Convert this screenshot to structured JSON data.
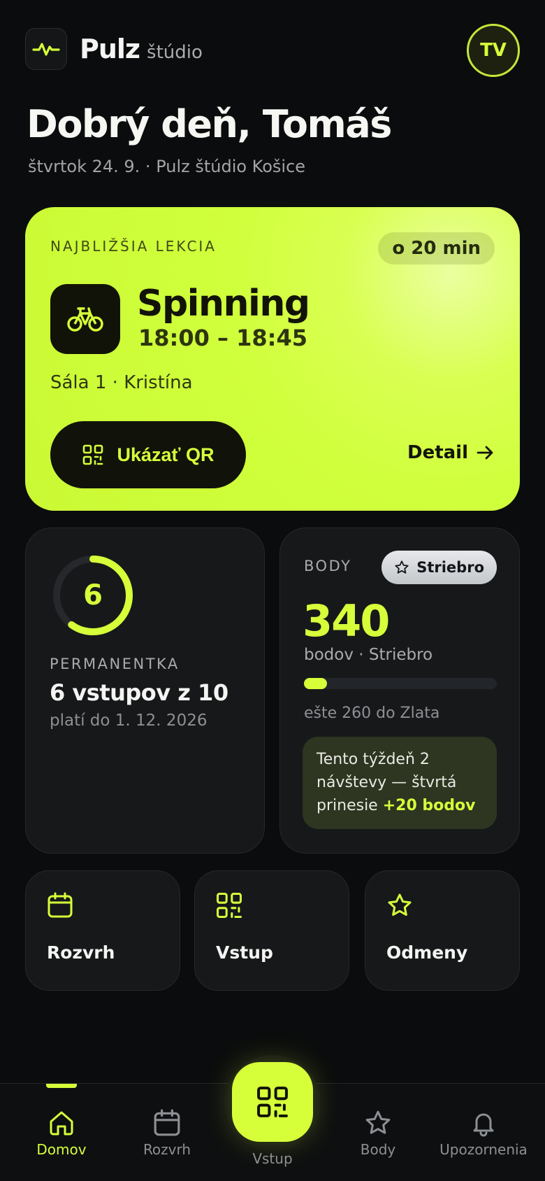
{
  "header": {
    "brand": "Pulz",
    "brand_suffix": "štúdio",
    "avatar_initials": "TV"
  },
  "greeting": {
    "title": "Dobrý deň, Tomáš",
    "subtitle": "štvrtok 24. 9. · Pulz štúdio Košice"
  },
  "next_class": {
    "label": "NAJBLIŽŠIA LEKCIA",
    "badge": "o 20 min",
    "name": "Spinning",
    "time": "18:00 – 18:45",
    "place": "Sála 1 · Kristína",
    "qr_button": "Ukázať QR",
    "detail_link": "Detail"
  },
  "pass": {
    "count": "6",
    "used": 6,
    "total": 10,
    "label": "PERMANENTKA",
    "value": "6 vstupov z 10",
    "valid": "platí do 1. 12. 2026"
  },
  "points": {
    "label": "BODY",
    "tier": "Striebro",
    "value": "340",
    "sub": "bodov · Striebro",
    "progress": 0.12,
    "remaining": "ešte 260 do Zlata",
    "tip_text": "Tento týždeň 2 návštevy — štvrtá prinesie ",
    "tip_bonus": "+20 bodov"
  },
  "quick_actions": [
    {
      "label": "Rozvrh",
      "icon": "calendar-icon"
    },
    {
      "label": "Vstup",
      "icon": "qr-icon"
    },
    {
      "label": "Odmeny",
      "icon": "star-icon"
    }
  ],
  "nav": {
    "items": [
      {
        "label": "Domov",
        "icon": "home-icon",
        "active": true
      },
      {
        "label": "Rozvrh",
        "icon": "calendar-icon"
      },
      {
        "label": "Vstup",
        "icon": "qr-icon"
      },
      {
        "label": "Body",
        "icon": "star-icon"
      },
      {
        "label": "Upozornenia",
        "icon": "bell-icon"
      }
    ]
  },
  "colors": {
    "accent": "#d6ff3a",
    "background": "#0b0c0d",
    "card": "#17181a"
  }
}
